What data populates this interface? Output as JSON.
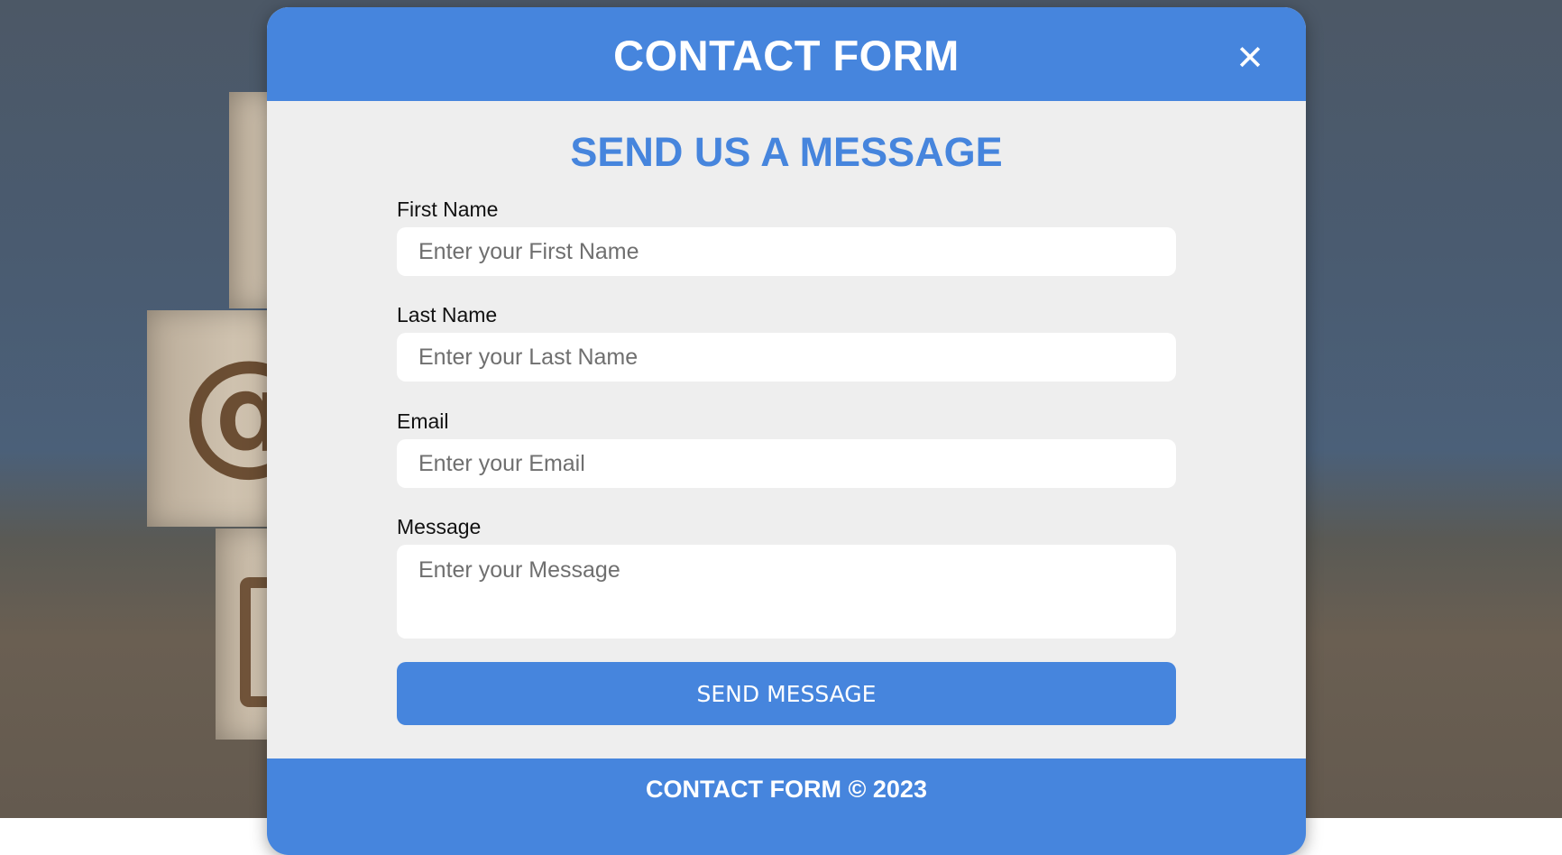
{
  "modal": {
    "title": "CONTACT FORM",
    "close_icon": "close-icon"
  },
  "form": {
    "heading": "SEND US A MESSAGE",
    "fields": [
      {
        "label": "First Name",
        "placeholder": "Enter your First Name"
      },
      {
        "label": "Last Name",
        "placeholder": "Enter your Last Name"
      },
      {
        "label": "Email",
        "placeholder": "Enter your Email"
      },
      {
        "label": "Message",
        "placeholder": "Enter your Message"
      }
    ],
    "submit_label": "SEND MESSAGE"
  },
  "footer": {
    "text": "CONTACT FORM © 2023"
  },
  "colors": {
    "accent": "#4685dd",
    "panel": "#eeeeee"
  }
}
